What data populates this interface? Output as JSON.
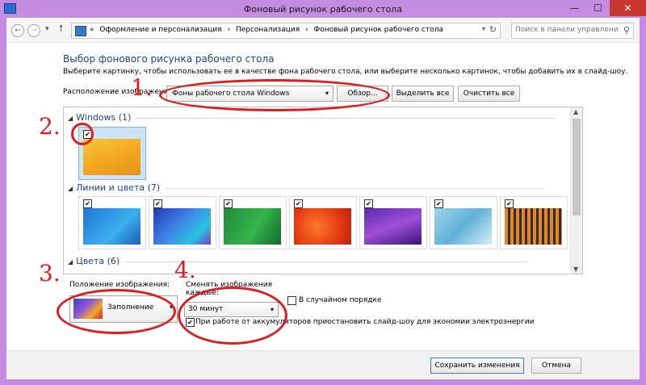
{
  "window": {
    "title": "Фоновый рисунок рабочего стола",
    "minimize": "—",
    "maximize": "☐",
    "close": "✕"
  },
  "nav": {
    "back": "←",
    "forward": "→",
    "history": "▾",
    "up": "↑",
    "breadcrumbs": [
      "«",
      "Оформление и персонализация",
      "›",
      "Персонализация",
      "›",
      "Фоновый рисунок рабочего стола"
    ],
    "dropdown": "▾",
    "refresh": "↻",
    "search_placeholder": "Поиск в панели управления",
    "search_icon": "⚲"
  },
  "heading": "Выбор фонового рисунка рабочего стола",
  "description": "Выберите картинку, чтобы использовать ее в качестве фона рабочего стола, или выберите несколько картинок, чтобы добавить их в слайд-шоу.",
  "location": {
    "label": "Расположение изображения:",
    "value": "Фоны рабочего стола Windows",
    "browse": "Обзор...",
    "select_all": "Выделить все",
    "clear_all": "Очистить все"
  },
  "groups": [
    {
      "name": "Windows (1)",
      "images": 1
    },
    {
      "name": "Линии и цвета (7)",
      "images": 7
    },
    {
      "name": "Цвета (6)",
      "images": 6
    }
  ],
  "checkmark": "✔",
  "position": {
    "label": "Положение изображения:",
    "value": "Заполнение"
  },
  "interval": {
    "label": "Сменять изображения каждые:",
    "value": "30 минут"
  },
  "shuffle": {
    "label": "В случайном порядке",
    "checked": false
  },
  "battery": {
    "label": "При работе от аккумуляторов приостановить слайд-шоу для экономии электроэнергии",
    "checked": true
  },
  "footer": {
    "save": "Сохранить изменения",
    "cancel": "Отмена"
  },
  "annotations": [
    "1.",
    "2.",
    "3.",
    "4."
  ],
  "colors": {
    "title_bar": "#c58be0",
    "close_button": "#c7372f",
    "heading": "#1e3f8f",
    "annotation": "#e11b1b"
  }
}
